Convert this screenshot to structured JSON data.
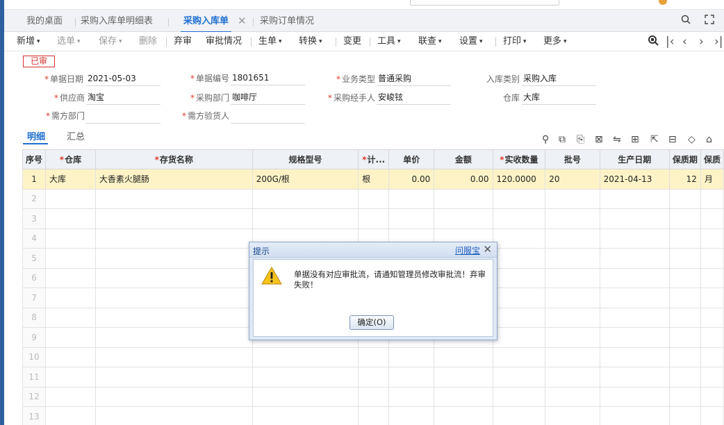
{
  "tabs": [
    {
      "label": "我的桌面"
    },
    {
      "label": "采购入库单明细表"
    },
    {
      "label": "采购入库单"
    },
    {
      "label": "采购订单情况"
    }
  ],
  "toolbar": {
    "items": [
      "新增",
      "选单",
      "保存",
      "删除",
      "弃审",
      "审批情况",
      "生单",
      "转换",
      "变更",
      "工具",
      "联查",
      "设置",
      "打印",
      "更多"
    ]
  },
  "status_stamp": "已审",
  "form": {
    "doc_date_label": "单据日期",
    "doc_date": "2021-05-03",
    "doc_no_label": "单据编号",
    "doc_no": "1801651",
    "biz_type_label": "业务类型",
    "biz_type": "普通采购",
    "in_type_label": "入库类别",
    "in_type": "采购入库",
    "supplier_label": "供应商",
    "supplier": "淘宝",
    "dept_label": "采购部门",
    "dept": "咖啡厅",
    "buyer_label": "采购经手人",
    "buyer": "安峻铉",
    "warehouse_label": "仓库",
    "warehouse": "大库",
    "demand_dept_label": "需方部门",
    "demand_dept": "",
    "inspector_label": "需方验货人",
    "inspector": ""
  },
  "subtabs": [
    "明细",
    "汇总"
  ],
  "grid": {
    "headers": [
      "序号",
      "仓库",
      "存货名称",
      "规格型号",
      "计...",
      "单价",
      "金额",
      "实收数量",
      "批号",
      "生产日期",
      "保质期",
      "保质"
    ],
    "rows": [
      [
        "1",
        "大库",
        "大香素火腿肠",
        "200G/根",
        "根",
        "0.00",
        "0.00",
        "120.0000",
        "20",
        "2021-04-13",
        "12",
        "月"
      ]
    ],
    "empty_row_numbers": [
      "2",
      "3",
      "4",
      "5",
      "6",
      "7",
      "8",
      "9",
      "10",
      "11",
      "12",
      "13"
    ]
  },
  "dialog": {
    "title": "提示",
    "help_link": "问服宝",
    "message": "单据没有对应审批流，请通知管理员修改审批流！弃审失败！",
    "ok_label": "确定(O)"
  }
}
